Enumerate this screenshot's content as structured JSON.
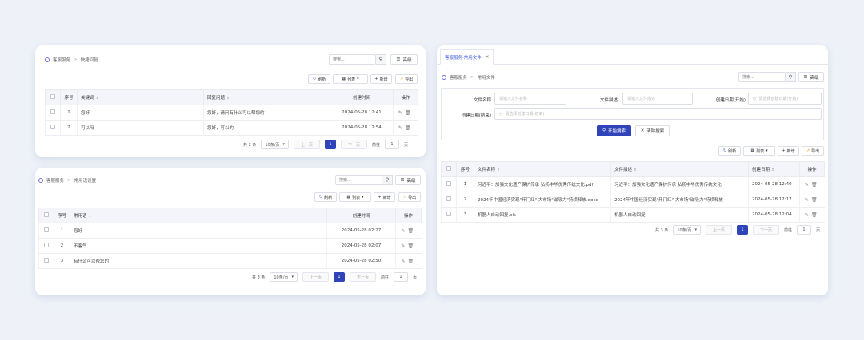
{
  "common": {
    "search_placeholder": "搜索...",
    "advanced_label": "高级",
    "refresh_label": "刷新",
    "list_label": "列表",
    "add_label": "新增",
    "export_label": "导出",
    "per_page": "10条/页",
    "prev": "上一页",
    "next": "下一页",
    "goto_prefix": "前往",
    "goto_suffix": "页",
    "current_page": "1",
    "goto_value": "1"
  },
  "panel1": {
    "breadcrumb": [
      "客服服务",
      "快捷回复"
    ],
    "headers": [
      "序号",
      "关键词",
      "回复问题",
      "创建时间",
      "操作"
    ],
    "rows": [
      {
        "no": "1",
        "keyword": "您好",
        "reply": "您好，请问有什么可以帮您的",
        "created": "2024-05-28 12:41"
      },
      {
        "no": "2",
        "keyword": "可以吗",
        "reply": "您好，可以的",
        "created": "2024-05-28 12:54"
      }
    ],
    "total": "共 2 条"
  },
  "panel2": {
    "breadcrumb": [
      "客服服务",
      "常用语设置"
    ],
    "headers": [
      "序号",
      "常用语",
      "创建时间",
      "操作"
    ],
    "rows": [
      {
        "no": "1",
        "phrase": "您好",
        "created": "2024-05-28 02:27"
      },
      {
        "no": "2",
        "phrase": "不客气",
        "created": "2024-05-28 02:07"
      },
      {
        "no": "3",
        "phrase": "有什么可以帮您的",
        "created": "2024-05-28 02:50"
      }
    ],
    "total": "共 3 条"
  },
  "panel3": {
    "tab_label": "客服服务·常用文件",
    "breadcrumb": [
      "客服服务",
      "常用文件"
    ],
    "form": {
      "file_name_label": "文件名称",
      "file_name_placeholder": "请输入文件名称",
      "file_desc_label": "文件描述",
      "file_desc_placeholder": "请输入文件描述",
      "date_start_label": "创建日期(开始)",
      "date_start_placeholder": "请选择创建日期(开始)",
      "date_end_label": "创建日期(结束)",
      "date_end_placeholder": "请选择创建日期(结束)",
      "search_btn": "开始搜索",
      "clear_btn": "清除搜索"
    },
    "headers": [
      "序号",
      "文件名称",
      "文件描述",
      "创建日期",
      "操作"
    ],
    "rows": [
      {
        "no": "1",
        "name": "习近平：加强文化遗产保护传承 弘扬中华优秀传统文化.pdf",
        "desc": "习近平：加强文化遗产保护传承 弘扬中华优秀传统文化",
        "created": "2024-05-28 12:40"
      },
      {
        "no": "2",
        "name": "2024年中国经济实现\"开门红\" 大市场\"磁吸力\"持续释放.docx",
        "desc": "2024年中国经济实现\"开门红\" 大市场\"磁吸力\"持续释放",
        "created": "2024-05-28 12:17"
      },
      {
        "no": "3",
        "name": "机器人自动回复.xls",
        "desc": "机器人自动回复",
        "created": "2024-05-28 12:04"
      }
    ],
    "total": "共 3 条"
  }
}
